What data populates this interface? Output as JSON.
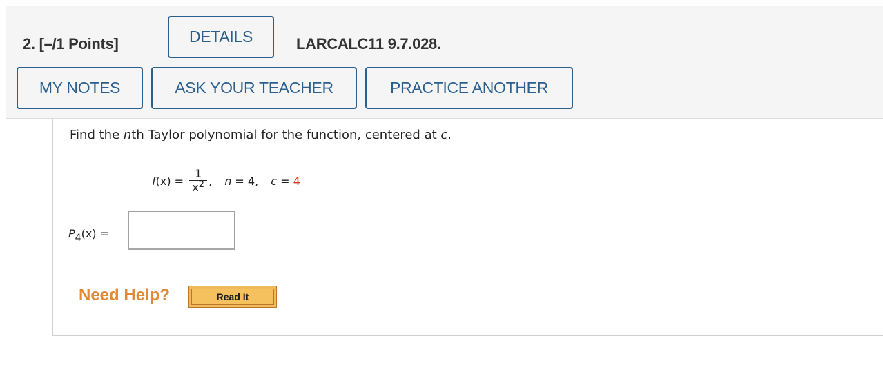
{
  "header": {
    "question_number": "2.",
    "points": "[–/1 Points]",
    "details_label": "DETAILS",
    "problem_code": "LARCALC11 9.7.028.",
    "my_notes_label": "MY NOTES",
    "ask_teacher_label": "ASK YOUR TEACHER",
    "practice_another_label": "PRACTICE ANOTHER"
  },
  "question": {
    "prompt_before_n": "Find the ",
    "prompt_n": "n",
    "prompt_middle": "th Taylor polynomial for the function, centered at ",
    "prompt_c": "c",
    "prompt_end": ".",
    "function_lhs_f": "f",
    "function_lhs_rest": "(x) =",
    "numerator": "1",
    "denominator_base": "x",
    "denominator_exp": "2",
    "comma1": ",",
    "n_var": "n",
    "n_value": "= 4,",
    "c_var": "c",
    "c_equals": "=",
    "c_value": "4",
    "answer_label_p": "P",
    "answer_label_sub": "4",
    "answer_label_rest": "(x)  =",
    "answer_value": "",
    "answer_placeholder": ""
  },
  "help": {
    "need_help_label": "Need Help?",
    "read_it_label": "Read It"
  },
  "colors": {
    "button_blue": "#2b5f8e",
    "highlight_red": "#d9341e",
    "help_orange": "#e08a38",
    "read_it_fill": "#f4c15e"
  }
}
